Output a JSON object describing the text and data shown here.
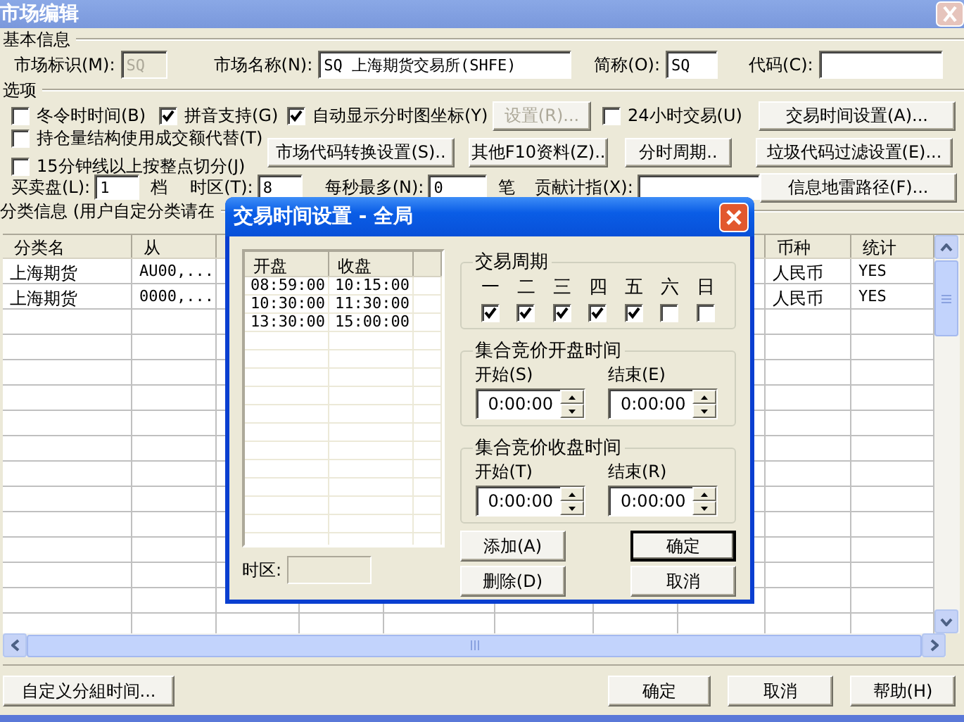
{
  "window": {
    "title": "市场编辑"
  },
  "basic_info": {
    "label": "基本信息",
    "fields": [
      {
        "label": "市场标识(M):",
        "value": "SQ",
        "disabled": true
      },
      {
        "label": "市场名称(N):",
        "value": "SQ 上海期货交易所(SHFE)",
        "disabled": false
      },
      {
        "label": "简称(O):",
        "value": "SQ",
        "disabled": false
      },
      {
        "label": "代码(C):",
        "disabled": false
      }
    ]
  },
  "options": {
    "label": "选项",
    "checkboxes": [
      {
        "label": "冬令时时间(B)",
        "checked": false
      },
      {
        "label": "拼音支持(G)",
        "checked": true
      },
      {
        "label": "自动显示分时图坐标(Y)",
        "checked": true
      },
      {
        "label": "24小时交易(U)",
        "checked": false
      },
      {
        "label": "持仓量结构使用成交额代替(T)",
        "checked": false
      },
      {
        "label": "15分钟线以上按整点切分(J)",
        "checked": false
      }
    ],
    "buttons": [
      {
        "label": "设置(R)...",
        "disabled": true
      },
      {
        "label": "交易时间设置(A)...",
        "disabled": false
      },
      {
        "label": "市场代码转换设置(S)..",
        "disabled": false
      },
      {
        "label": "其他F10资料(Z)..",
        "disabled": false
      },
      {
        "label": "分时周期..",
        "disabled": false
      },
      {
        "label": "垃圾代码过滤设置(E)...",
        "disabled": false
      },
      {
        "label": "信息地雷路径(F)...",
        "disabled": false
      }
    ],
    "fields": [
      {
        "label": "买卖盘(L):",
        "value": "1",
        "unit": "档"
      },
      {
        "label": "时区(T):",
        "value": "8"
      },
      {
        "label": "每秒最多(N):",
        "value": "0",
        "unit": "笔"
      },
      {
        "label": "贡献计指(X):"
      }
    ]
  },
  "category": {
    "label": "分类信息 (用户自定分类请在",
    "table": {
      "columns": [
        "分类名",
        "从",
        "币种",
        "统计"
      ],
      "rows": [
        [
          "上海期货",
          "AU00,...",
          "人民币",
          "YES"
        ],
        [
          "上海期货",
          "0000,...",
          "人民币",
          "YES"
        ]
      ]
    }
  },
  "bottom_buttons": [
    {
      "label": "自定义分組时间..."
    },
    {
      "label": "确定"
    },
    {
      "label": "取消"
    },
    {
      "label": "帮助(H)"
    }
  ],
  "dialog": {
    "title": "交易时间设置 - 全局",
    "sessions": {
      "columns": [
        "开盘",
        "收盘"
      ],
      "rows": [
        [
          "08:59:00",
          "10:15:00"
        ],
        [
          "10:30:00",
          "11:30:00"
        ],
        [
          "13:30:00",
          "15:00:00"
        ]
      ]
    },
    "timezone": {
      "label": "时区:"
    },
    "week": {
      "label": "交易周期",
      "days": [
        {
          "label": "一",
          "checked": true
        },
        {
          "label": "二",
          "checked": true
        },
        {
          "label": "三",
          "checked": true
        },
        {
          "label": "四",
          "checked": true
        },
        {
          "label": "五",
          "checked": true
        },
        {
          "label": "六",
          "checked": false
        },
        {
          "label": "日",
          "checked": false
        }
      ]
    },
    "auctions": [
      {
        "label": "集合竞价开盘时间",
        "start": {
          "label": "开始(S)",
          "value": "0:00:00"
        },
        "end": {
          "label": "结束(E)",
          "value": "0:00:00"
        }
      },
      {
        "label": "集合竞价收盘时间",
        "start": {
          "label": "开始(T)",
          "value": "0:00:00"
        },
        "end": {
          "label": "结束(R)",
          "value": "0:00:00"
        }
      }
    ],
    "buttons": [
      {
        "label": "添加(A)",
        "default": false
      },
      {
        "label": "确定",
        "default": true
      },
      {
        "label": "删除(D)",
        "default": false
      },
      {
        "label": "取消",
        "default": false
      }
    ]
  }
}
